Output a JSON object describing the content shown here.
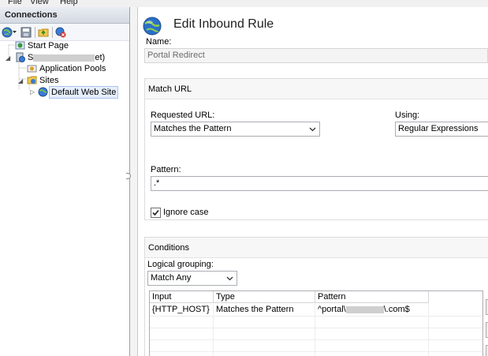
{
  "menu": [
    "File",
    "View",
    "Help"
  ],
  "connections": {
    "title": "Connections",
    "tree": [
      {
        "label": "Start Page"
      },
      {
        "label_prefix": "S",
        "label_suffix": "et)"
      },
      {
        "label": "Application Pools"
      },
      {
        "label": "Sites"
      },
      {
        "label": "Default Web Site"
      }
    ]
  },
  "page": {
    "title": "Edit Inbound Rule",
    "name_label": "Name:",
    "name_value": "Portal Redirect"
  },
  "match_url": {
    "header": "Match URL",
    "requested_url_label": "Requested URL:",
    "requested_url_value": "Matches the Pattern",
    "using_label": "Using:",
    "using_value": "Regular Expressions",
    "pattern_label": "Pattern:",
    "pattern_value": ".*",
    "ignore_case_label": "Ignore case",
    "ignore_case_checked": true
  },
  "conditions": {
    "header": "Conditions",
    "logical_grouping_label": "Logical grouping:",
    "logical_grouping_value": "Match Any",
    "columns": [
      "Input",
      "Type",
      "Pattern"
    ],
    "rows": [
      {
        "input": "{HTTP_HOST}",
        "type": "Matches the Pattern",
        "pattern_prefix": "^portal\\",
        "pattern_suffix": "\\.com$"
      }
    ]
  }
}
